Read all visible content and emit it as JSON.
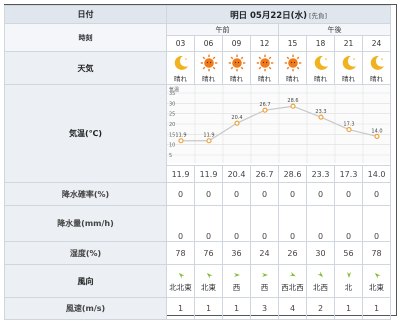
{
  "header": {
    "label": "日付",
    "date": "明日 05月22日(水)",
    "badge": "[先負]"
  },
  "period": {
    "label": "時刻",
    "am": "午前",
    "pm": "午後"
  },
  "hours": [
    "03",
    "06",
    "09",
    "12",
    "15",
    "18",
    "21",
    "24"
  ],
  "weather": {
    "label": "天気",
    "items": [
      {
        "icon": "moon-icon",
        "text": "晴れ"
      },
      {
        "icon": "sun-icon",
        "text": "晴れ"
      },
      {
        "icon": "sun-icon",
        "text": "晴れ"
      },
      {
        "icon": "sun-icon",
        "text": "晴れ"
      },
      {
        "icon": "sun-icon",
        "text": "晴れ"
      },
      {
        "icon": "moon-icon",
        "text": "晴れ"
      },
      {
        "icon": "moon-icon",
        "text": "晴れ"
      },
      {
        "icon": "moon-icon",
        "text": "晴れ"
      }
    ]
  },
  "temperature": {
    "label": "気温(℃)",
    "values": [
      "11.9",
      "11.9",
      "20.4",
      "26.7",
      "28.6",
      "23.3",
      "17.3",
      "14.0"
    ]
  },
  "chart_data": {
    "type": "line",
    "x": [
      "03",
      "06",
      "09",
      "12",
      "15",
      "18",
      "21",
      "24"
    ],
    "series": [
      {
        "values": [
          11.9,
          11.9,
          20.4,
          26.7,
          28.6,
          23.3,
          17.3,
          14.0
        ]
      }
    ],
    "ylabel": "気温",
    "yticks": [
      5,
      10,
      15,
      20,
      25,
      30,
      35
    ],
    "ylim": [
      5,
      35
    ],
    "grid": true,
    "line_color": "#c8c8c8",
    "marker_color": "#f39b2b"
  },
  "precip_prob": {
    "label": "降水確率(%)",
    "values": [
      "0",
      "0",
      "0",
      "0",
      "0",
      "0",
      "0",
      "0"
    ]
  },
  "precip_amount": {
    "label": "降水量(mm/h)",
    "values": [
      "0",
      "0",
      "0",
      "0",
      "0",
      "0",
      "0",
      "0"
    ]
  },
  "humidity": {
    "label": "湿度(%)",
    "values": [
      "78",
      "76",
      "36",
      "24",
      "26",
      "30",
      "56",
      "78"
    ]
  },
  "wind_direction": {
    "label": "風向",
    "items": [
      {
        "text": "北北東",
        "icon": "wind-arrow-icon"
      },
      {
        "text": "北東",
        "icon": "wind-arrow-icon"
      },
      {
        "text": "西",
        "icon": "wind-arrow-icon"
      },
      {
        "text": "西",
        "icon": "wind-arrow-icon"
      },
      {
        "text": "西北西",
        "icon": "wind-arrow-icon"
      },
      {
        "text": "北西",
        "icon": "wind-arrow-icon"
      },
      {
        "text": "北",
        "icon": "wind-arrow-icon"
      },
      {
        "text": "北東",
        "icon": "wind-arrow-icon"
      }
    ]
  },
  "wind_speed": {
    "label": "風速(m/s)",
    "values": [
      "1",
      "1",
      "1",
      "3",
      "4",
      "2",
      "1",
      "1"
    ]
  },
  "colors": {
    "header_bg": "#dfe6ee",
    "label_bg": "#eceff3",
    "sun": "#f07a1a",
    "moon": "#f0b320",
    "wind_arrow": "#7dbb2a"
  }
}
